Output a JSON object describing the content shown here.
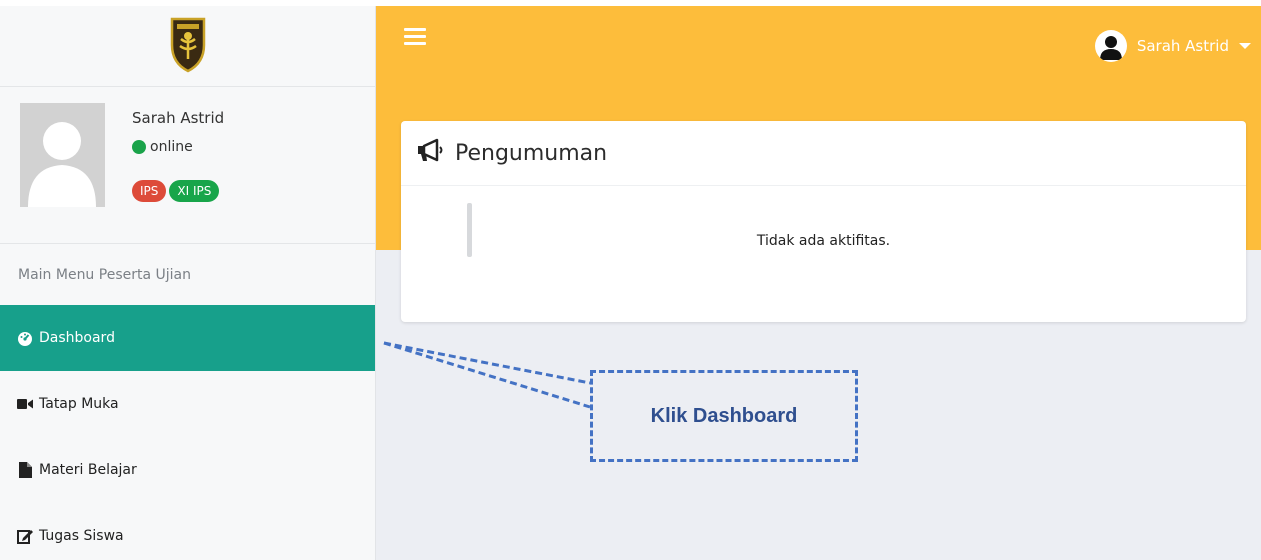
{
  "topbar": {
    "user_name": "Sarah Astrid"
  },
  "user_panel": {
    "name": "Sarah Astrid",
    "status": "online",
    "badges": [
      {
        "label": "IPS",
        "color": "#dd4b39"
      },
      {
        "label": "XI IPS",
        "color": "#18a54a"
      }
    ]
  },
  "sidebar": {
    "header": "Main Menu Peserta Ujian",
    "items": [
      {
        "label": "Dashboard",
        "icon": "dashboard-icon",
        "active": true
      },
      {
        "label": "Tatap Muka",
        "icon": "video-camera-icon",
        "active": false
      },
      {
        "label": "Materi Belajar",
        "icon": "file-icon",
        "active": false
      },
      {
        "label": "Tugas Siswa",
        "icon": "edit-icon",
        "active": false
      }
    ]
  },
  "announcement": {
    "title": "Pengumuman",
    "empty_message": "Tidak ada aktifitas."
  },
  "callout": {
    "text": "Klik Dashboard"
  },
  "colors": {
    "topbar": "#fdbd3b",
    "active_menu": "#17a08b",
    "callout_border": "#4472c4",
    "callout_text": "#2f4f8f"
  }
}
